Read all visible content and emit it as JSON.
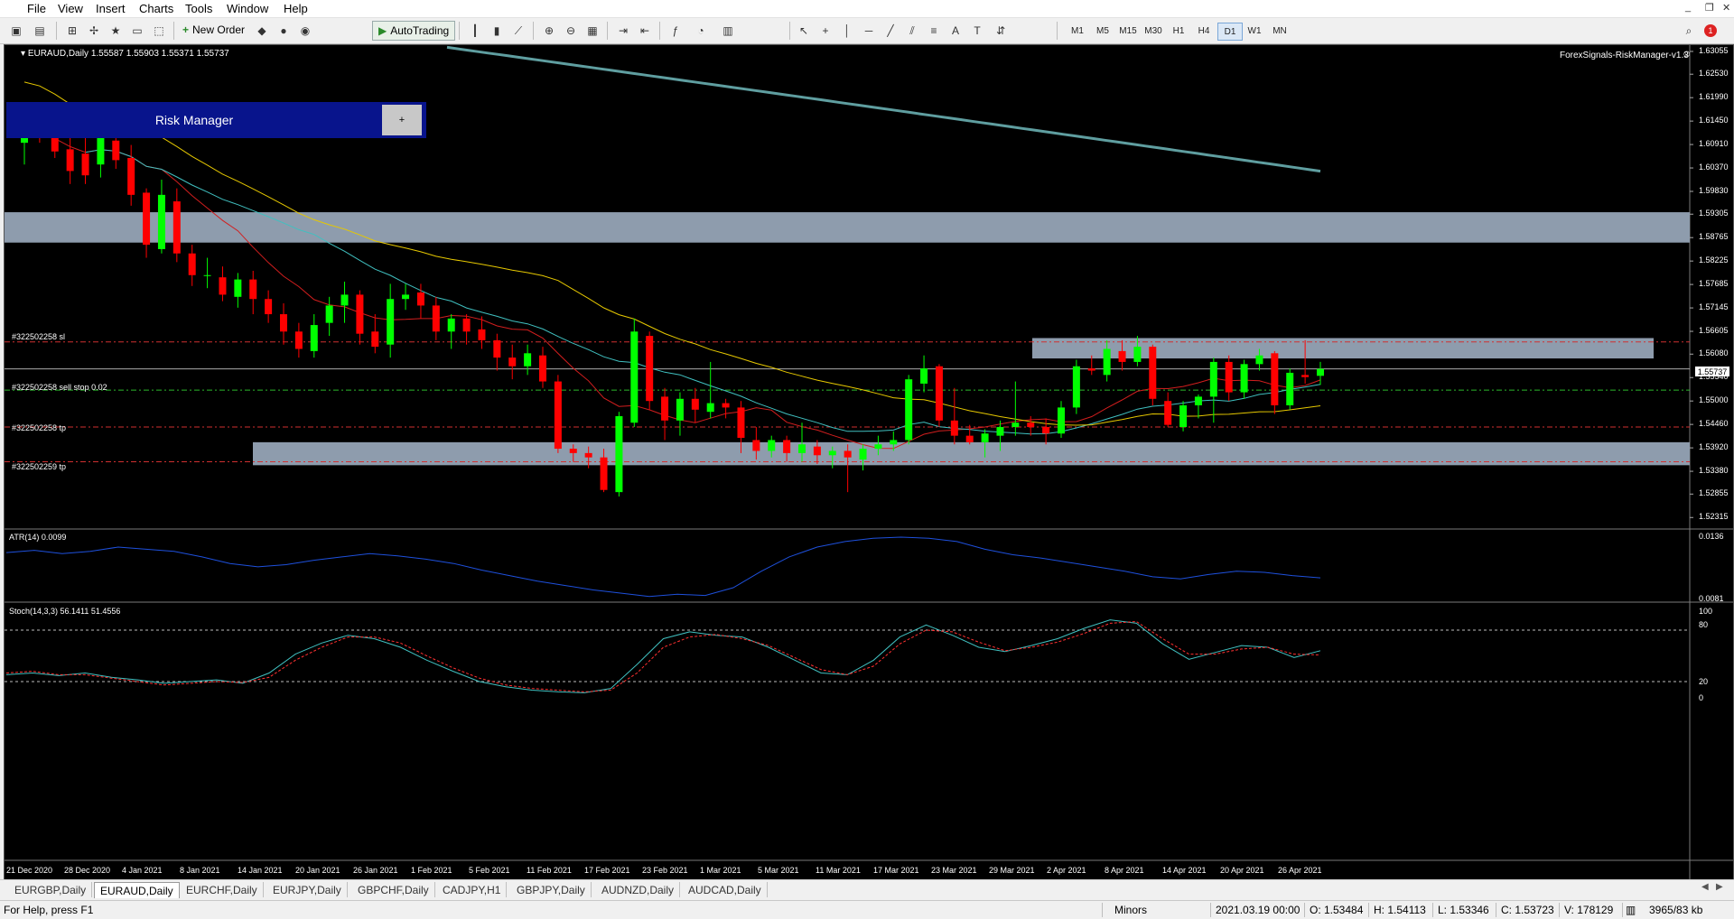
{
  "menu": [
    "File",
    "View",
    "Insert",
    "Charts",
    "Tools",
    "Window",
    "Help"
  ],
  "toolbar": {
    "new_order_label": "New Order",
    "autotrading_label": "AutoTrading",
    "timeframes": [
      "M1",
      "M5",
      "M15",
      "M30",
      "H1",
      "H4",
      "D1",
      "W1",
      "MN"
    ],
    "active_timeframe": "D1",
    "notification_count": "1"
  },
  "chart": {
    "symbol_info": "EURAUD,Daily  1.55587 1.55903 1.55371 1.55737",
    "ea_name": "ForexSignals-RiskManager-v1.3",
    "risk_manager": {
      "title": "Risk Manager",
      "button": "+"
    },
    "order_lines": [
      {
        "label": "#322502258 sl"
      },
      {
        "label": "#322502258 sell stop 0.02"
      },
      {
        "label": "#322502258 tp"
      },
      {
        "label": "#322502259 tp"
      }
    ],
    "price_axis": [
      "1.63055",
      "1.62530",
      "1.61990",
      "1.61450",
      "1.60910",
      "1.60370",
      "1.59830",
      "1.59305",
      "1.58765",
      "1.58225",
      "1.57685",
      "1.57145",
      "1.56605",
      "1.56080",
      "1.55540",
      "1.55000",
      "1.54460",
      "1.53920",
      "1.53380",
      "1.52855",
      "1.52315"
    ],
    "current_price": "1.55737",
    "date_axis": [
      "21 Dec 2020",
      "28 Dec 2020",
      "4 Jan 2021",
      "8 Jan 2021",
      "14 Jan 2021",
      "20 Jan 2021",
      "26 Jan 2021",
      "1 Feb 2021",
      "5 Feb 2021",
      "11 Feb 2021",
      "17 Feb 2021",
      "23 Feb 2021",
      "1 Mar 2021",
      "5 Mar 2021",
      "11 Mar 2021",
      "17 Mar 2021",
      "23 Mar 2021",
      "29 Mar 2021",
      "2 Apr 2021",
      "8 Apr 2021",
      "14 Apr 2021",
      "20 Apr 2021",
      "26 Apr 2021"
    ],
    "atr": {
      "label": "ATR(14) 0.0099",
      "axis": [
        "0.0136",
        "0.0081"
      ]
    },
    "stoch": {
      "label": "Stoch(14,3,3) 56.1411 51.4556",
      "axis": [
        "100",
        "80",
        "20",
        "0"
      ]
    },
    "colors": {
      "bull": "#00ff00",
      "bear": "#ff0000",
      "zone": "#8e9cad",
      "ma200": "#5f9ea0",
      "ma50": "#e6c800",
      "ma20": "#40c0c0",
      "ma10": "#d21e1e",
      "atr": "#1e50dc"
    }
  },
  "chart_data": {
    "type": "candlestick",
    "title": "EURAUD,Daily",
    "ylim": [
      1.5205,
      1.632
    ],
    "x": [
      "21 Dec 2020",
      "28 Dec 2020",
      "4 Jan 2021",
      "8 Jan 2021",
      "14 Jan 2021",
      "20 Jan 2021",
      "26 Jan 2021",
      "1 Feb 2021",
      "5 Feb 2021",
      "11 Feb 2021",
      "17 Feb 2021",
      "23 Feb 2021",
      "1 Mar 2021",
      "5 Mar 2021",
      "11 Mar 2021",
      "17 Mar 2021",
      "23 Mar 2021",
      "29 Mar 2021",
      "2 Apr 2021",
      "8 Apr 2021",
      "14 Apr 2021",
      "20 Apr 2021",
      "26 Apr 2021"
    ],
    "candles": [
      {
        "o": 1.6095,
        "h": 1.6165,
        "l": 1.6045,
        "c": 1.6125
      },
      {
        "o": 1.614,
        "h": 1.6175,
        "l": 1.6095,
        "c": 1.6115
      },
      {
        "o": 1.6135,
        "h": 1.6185,
        "l": 1.606,
        "c": 1.6075
      },
      {
        "o": 1.608,
        "h": 1.6125,
        "l": 1.6,
        "c": 1.603
      },
      {
        "o": 1.607,
        "h": 1.611,
        "l": 1.6,
        "c": 1.602
      },
      {
        "o": 1.6045,
        "h": 1.614,
        "l": 1.6015,
        "c": 1.611
      },
      {
        "o": 1.61,
        "h": 1.615,
        "l": 1.6035,
        "c": 1.6055
      },
      {
        "o": 1.606,
        "h": 1.609,
        "l": 1.595,
        "c": 1.5975
      },
      {
        "o": 1.598,
        "h": 1.599,
        "l": 1.583,
        "c": 1.586
      },
      {
        "o": 1.585,
        "h": 1.601,
        "l": 1.584,
        "c": 1.5975
      },
      {
        "o": 1.596,
        "h": 1.599,
        "l": 1.582,
        "c": 1.584
      },
      {
        "o": 1.584,
        "h": 1.586,
        "l": 1.5765,
        "c": 1.579
      },
      {
        "o": 1.579,
        "h": 1.583,
        "l": 1.576,
        "c": 1.579
      },
      {
        "o": 1.5785,
        "h": 1.581,
        "l": 1.573,
        "c": 1.5745
      },
      {
        "o": 1.574,
        "h": 1.5795,
        "l": 1.5715,
        "c": 1.578
      },
      {
        "o": 1.578,
        "h": 1.58,
        "l": 1.57,
        "c": 1.5735
      },
      {
        "o": 1.5735,
        "h": 1.5755,
        "l": 1.568,
        "c": 1.57
      },
      {
        "o": 1.57,
        "h": 1.5725,
        "l": 1.563,
        "c": 1.566
      },
      {
        "o": 1.566,
        "h": 1.568,
        "l": 1.56,
        "c": 1.562
      },
      {
        "o": 1.5615,
        "h": 1.57,
        "l": 1.56,
        "c": 1.5675
      },
      {
        "o": 1.568,
        "h": 1.574,
        "l": 1.565,
        "c": 1.572
      },
      {
        "o": 1.572,
        "h": 1.5775,
        "l": 1.568,
        "c": 1.5745
      },
      {
        "o": 1.5745,
        "h": 1.5755,
        "l": 1.563,
        "c": 1.5655
      },
      {
        "o": 1.566,
        "h": 1.57,
        "l": 1.561,
        "c": 1.5625
      },
      {
        "o": 1.563,
        "h": 1.577,
        "l": 1.56,
        "c": 1.5735
      },
      {
        "o": 1.5735,
        "h": 1.577,
        "l": 1.571,
        "c": 1.5745
      },
      {
        "o": 1.575,
        "h": 1.577,
        "l": 1.569,
        "c": 1.572
      },
      {
        "o": 1.572,
        "h": 1.574,
        "l": 1.564,
        "c": 1.566
      },
      {
        "o": 1.566,
        "h": 1.57,
        "l": 1.562,
        "c": 1.569
      },
      {
        "o": 1.569,
        "h": 1.57,
        "l": 1.563,
        "c": 1.566
      },
      {
        "o": 1.5665,
        "h": 1.5695,
        "l": 1.562,
        "c": 1.564
      },
      {
        "o": 1.564,
        "h": 1.5655,
        "l": 1.557,
        "c": 1.56
      },
      {
        "o": 1.56,
        "h": 1.563,
        "l": 1.555,
        "c": 1.558
      },
      {
        "o": 1.558,
        "h": 1.563,
        "l": 1.556,
        "c": 1.561
      },
      {
        "o": 1.5605,
        "h": 1.5625,
        "l": 1.553,
        "c": 1.5545
      },
      {
        "o": 1.5545,
        "h": 1.556,
        "l": 1.538,
        "c": 1.539
      },
      {
        "o": 1.539,
        "h": 1.54,
        "l": 1.536,
        "c": 1.538
      },
      {
        "o": 1.538,
        "h": 1.5395,
        "l": 1.5345,
        "c": 1.537
      },
      {
        "o": 1.537,
        "h": 1.539,
        "l": 1.529,
        "c": 1.5295
      },
      {
        "o": 1.529,
        "h": 1.5475,
        "l": 1.528,
        "c": 1.5465
      },
      {
        "o": 1.545,
        "h": 1.569,
        "l": 1.544,
        "c": 1.566
      },
      {
        "o": 1.565,
        "h": 1.566,
        "l": 1.548,
        "c": 1.55
      },
      {
        "o": 1.551,
        "h": 1.553,
        "l": 1.541,
        "c": 1.5455
      },
      {
        "o": 1.5455,
        "h": 1.552,
        "l": 1.542,
        "c": 1.5505
      },
      {
        "o": 1.5505,
        "h": 1.553,
        "l": 1.545,
        "c": 1.548
      },
      {
        "o": 1.5475,
        "h": 1.559,
        "l": 1.546,
        "c": 1.5495
      },
      {
        "o": 1.5495,
        "h": 1.5505,
        "l": 1.546,
        "c": 1.5485
      },
      {
        "o": 1.5485,
        "h": 1.55,
        "l": 1.538,
        "c": 1.5415
      },
      {
        "o": 1.541,
        "h": 1.544,
        "l": 1.5365,
        "c": 1.5385
      },
      {
        "o": 1.5385,
        "h": 1.542,
        "l": 1.537,
        "c": 1.541
      },
      {
        "o": 1.541,
        "h": 1.542,
        "l": 1.536,
        "c": 1.538
      },
      {
        "o": 1.538,
        "h": 1.545,
        "l": 1.536,
        "c": 1.54
      },
      {
        "o": 1.5395,
        "h": 1.541,
        "l": 1.5355,
        "c": 1.5375
      },
      {
        "o": 1.5375,
        "h": 1.5395,
        "l": 1.5345,
        "c": 1.5385
      },
      {
        "o": 1.5385,
        "h": 1.54,
        "l": 1.529,
        "c": 1.537
      },
      {
        "o": 1.5365,
        "h": 1.54,
        "l": 1.534,
        "c": 1.539
      },
      {
        "o": 1.539,
        "h": 1.542,
        "l": 1.5375,
        "c": 1.54
      },
      {
        "o": 1.54,
        "h": 1.543,
        "l": 1.5385,
        "c": 1.541
      },
      {
        "o": 1.541,
        "h": 1.556,
        "l": 1.54,
        "c": 1.555
      },
      {
        "o": 1.554,
        "h": 1.5605,
        "l": 1.552,
        "c": 1.5575
      },
      {
        "o": 1.558,
        "h": 1.5585,
        "l": 1.544,
        "c": 1.5455
      },
      {
        "o": 1.5455,
        "h": 1.553,
        "l": 1.54,
        "c": 1.542
      },
      {
        "o": 1.542,
        "h": 1.5445,
        "l": 1.54,
        "c": 1.5405
      },
      {
        "o": 1.5405,
        "h": 1.5435,
        "l": 1.537,
        "c": 1.5425
      },
      {
        "o": 1.542,
        "h": 1.5455,
        "l": 1.5385,
        "c": 1.544
      },
      {
        "o": 1.544,
        "h": 1.5545,
        "l": 1.542,
        "c": 1.545
      },
      {
        "o": 1.545,
        "h": 1.5465,
        "l": 1.542,
        "c": 1.544
      },
      {
        "o": 1.544,
        "h": 1.546,
        "l": 1.54,
        "c": 1.5425
      },
      {
        "o": 1.5425,
        "h": 1.55,
        "l": 1.5415,
        "c": 1.5485
      },
      {
        "o": 1.5485,
        "h": 1.5595,
        "l": 1.547,
        "c": 1.558
      },
      {
        "o": 1.5575,
        "h": 1.5605,
        "l": 1.556,
        "c": 1.557
      },
      {
        "o": 1.556,
        "h": 1.564,
        "l": 1.5545,
        "c": 1.562
      },
      {
        "o": 1.5615,
        "h": 1.564,
        "l": 1.557,
        "c": 1.559
      },
      {
        "o": 1.559,
        "h": 1.565,
        "l": 1.558,
        "c": 1.5625
      },
      {
        "o": 1.5625,
        "h": 1.563,
        "l": 1.549,
        "c": 1.5505
      },
      {
        "o": 1.55,
        "h": 1.552,
        "l": 1.544,
        "c": 1.5445
      },
      {
        "o": 1.544,
        "h": 1.55,
        "l": 1.543,
        "c": 1.549
      },
      {
        "o": 1.549,
        "h": 1.5515,
        "l": 1.546,
        "c": 1.551
      },
      {
        "o": 1.551,
        "h": 1.56,
        "l": 1.545,
        "c": 1.559
      },
      {
        "o": 1.559,
        "h": 1.5605,
        "l": 1.55,
        "c": 1.552
      },
      {
        "o": 1.552,
        "h": 1.5595,
        "l": 1.5505,
        "c": 1.5585
      },
      {
        "o": 1.5585,
        "h": 1.562,
        "l": 1.557,
        "c": 1.5605
      },
      {
        "o": 1.561,
        "h": 1.5615,
        "l": 1.547,
        "c": 1.549
      },
      {
        "o": 1.549,
        "h": 1.5575,
        "l": 1.548,
        "c": 1.5565
      },
      {
        "o": 1.556,
        "h": 1.564,
        "l": 1.554,
        "c": 1.5555
      },
      {
        "o": 1.5558,
        "h": 1.559,
        "l": 1.5537,
        "c": 1.5574
      }
    ],
    "series": [
      {
        "name": "ATR(14)",
        "values": [
          0.0122,
          0.0124,
          0.0121,
          0.0123,
          0.0127,
          0.0125,
          0.0123,
          0.0118,
          0.0112,
          0.0109,
          0.0111,
          0.0115,
          0.0118,
          0.0121,
          0.0119,
          0.0116,
          0.0112,
          0.0106,
          0.0101,
          0.0096,
          0.0092,
          0.0088,
          0.0085,
          0.0082,
          0.0084,
          0.0083,
          0.009,
          0.0105,
          0.0118,
          0.0127,
          0.0132,
          0.0135,
          0.0136,
          0.0135,
          0.0132,
          0.0125,
          0.012,
          0.0117,
          0.0113,
          0.0109,
          0.0105,
          0.01,
          0.0098,
          0.0102,
          0.0105,
          0.0104,
          0.0101,
          0.0099
        ]
      },
      {
        "name": "Stoch %K",
        "values": [
          28,
          30,
          27,
          30,
          25,
          22,
          18,
          20,
          22,
          18,
          30,
          52,
          65,
          74,
          70,
          60,
          45,
          32,
          20,
          14,
          10,
          8,
          7,
          12,
          40,
          70,
          78,
          74,
          72,
          60,
          45,
          30,
          28,
          45,
          72,
          86,
          74,
          60,
          55,
          62,
          70,
          82,
          92,
          88,
          64,
          46,
          54,
          62,
          60,
          48,
          56
        ]
      },
      {
        "name": "Stoch %D",
        "values": [
          30,
          32,
          28,
          28,
          24,
          20,
          16,
          18,
          20,
          19,
          25,
          45,
          60,
          72,
          72,
          65,
          50,
          36,
          24,
          16,
          12,
          10,
          8,
          10,
          30,
          60,
          72,
          75,
          70,
          62,
          48,
          34,
          28,
          38,
          64,
          80,
          78,
          66,
          56,
          60,
          66,
          76,
          88,
          90,
          70,
          52,
          52,
          58,
          60,
          52,
          51
        ]
      }
    ]
  },
  "tabs": [
    "EURGBP,Daily",
    "EURAUD,Daily",
    "EURCHF,Daily",
    "EURJPY,Daily",
    "GBPCHF,Daily",
    "CADJPY,H1",
    "GBPJPY,Daily",
    "AUDNZD,Daily",
    "AUDCAD,Daily"
  ],
  "active_tab": "EURAUD,Daily",
  "status": {
    "help": "For Help, press F1",
    "profile": "Minors",
    "datetime": "2021.03.19 00:00",
    "open": "O: 1.53484",
    "high": "H: 1.54113",
    "low": "L: 1.53346",
    "close": "C: 1.53723",
    "volume": "V: 178129",
    "traffic": "3965/83 kb"
  }
}
